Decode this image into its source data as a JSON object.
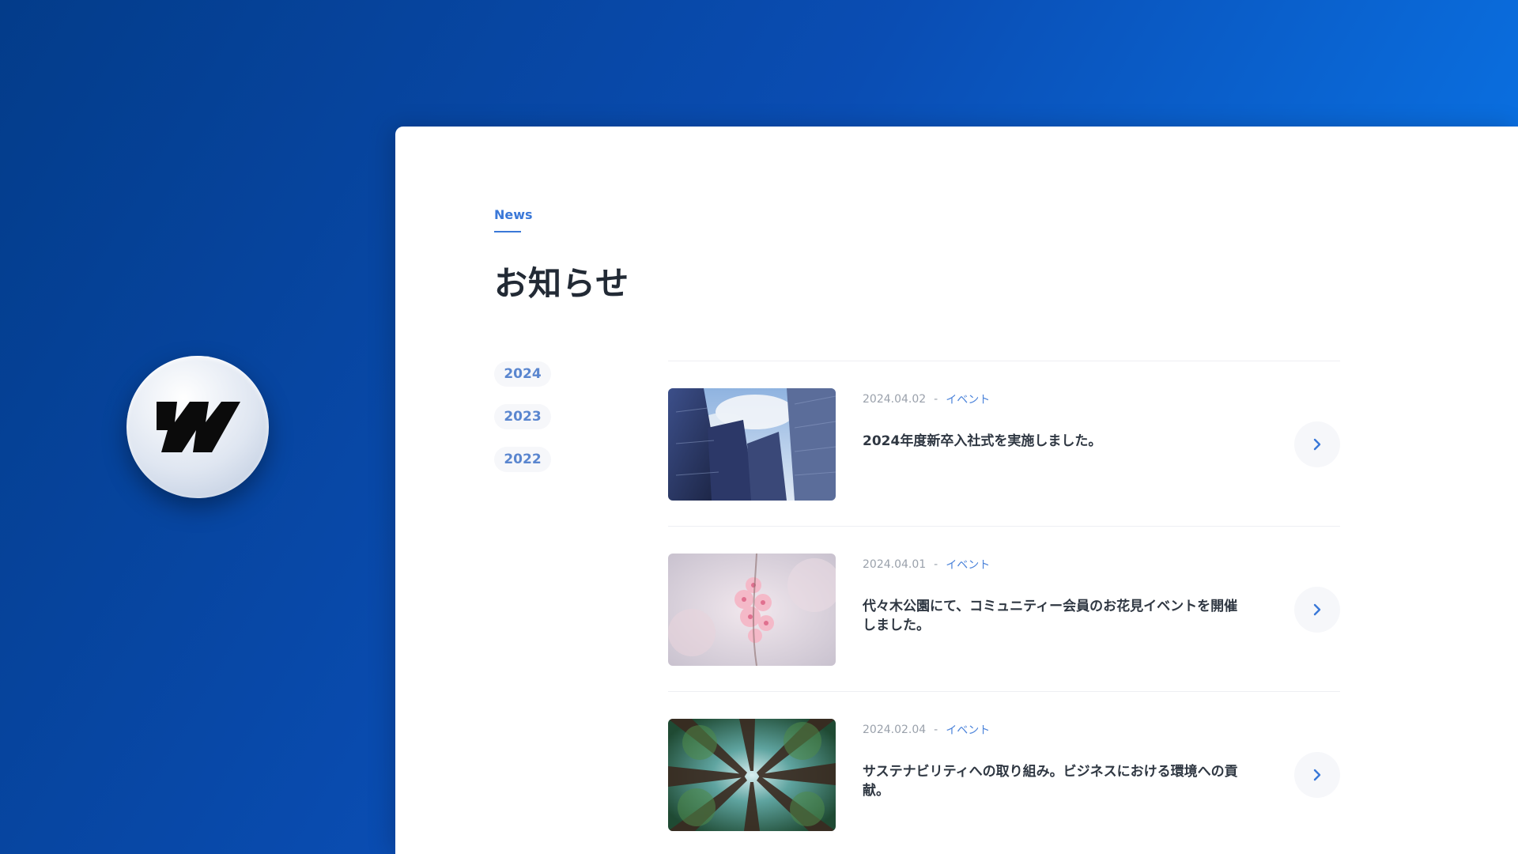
{
  "colors": {
    "accent": "#3a78d8",
    "background_gradient_start": "#033c8a",
    "background_gradient_end": "#0b86f2",
    "panel": "#ffffff",
    "heading": "#222a35"
  },
  "badge": {
    "icon": "webflow-logo-icon"
  },
  "header": {
    "eyebrow": "News",
    "title": "お知らせ"
  },
  "years": [
    {
      "label": "2024"
    },
    {
      "label": "2023"
    },
    {
      "label": "2022"
    }
  ],
  "news": [
    {
      "date": "2024.04.02",
      "separator": "-",
      "category": "イベント",
      "title": "2024年度新卒入社式を実施しました。",
      "image": "skyscrapers-thumbnail"
    },
    {
      "date": "2024.04.01",
      "separator": "-",
      "category": "イベント",
      "title": "代々木公園にて、コミュニティー会員のお花見イベントを開催しました。",
      "image": "cherry-blossom-thumbnail"
    },
    {
      "date": "2024.02.04",
      "separator": "-",
      "category": "イベント",
      "title": "サステナビリティへの取り組み。ビジネスにおける環境への貢献。",
      "image": "forest-canopy-thumbnail"
    }
  ],
  "icons": {
    "arrow": "chevron-right-icon"
  }
}
